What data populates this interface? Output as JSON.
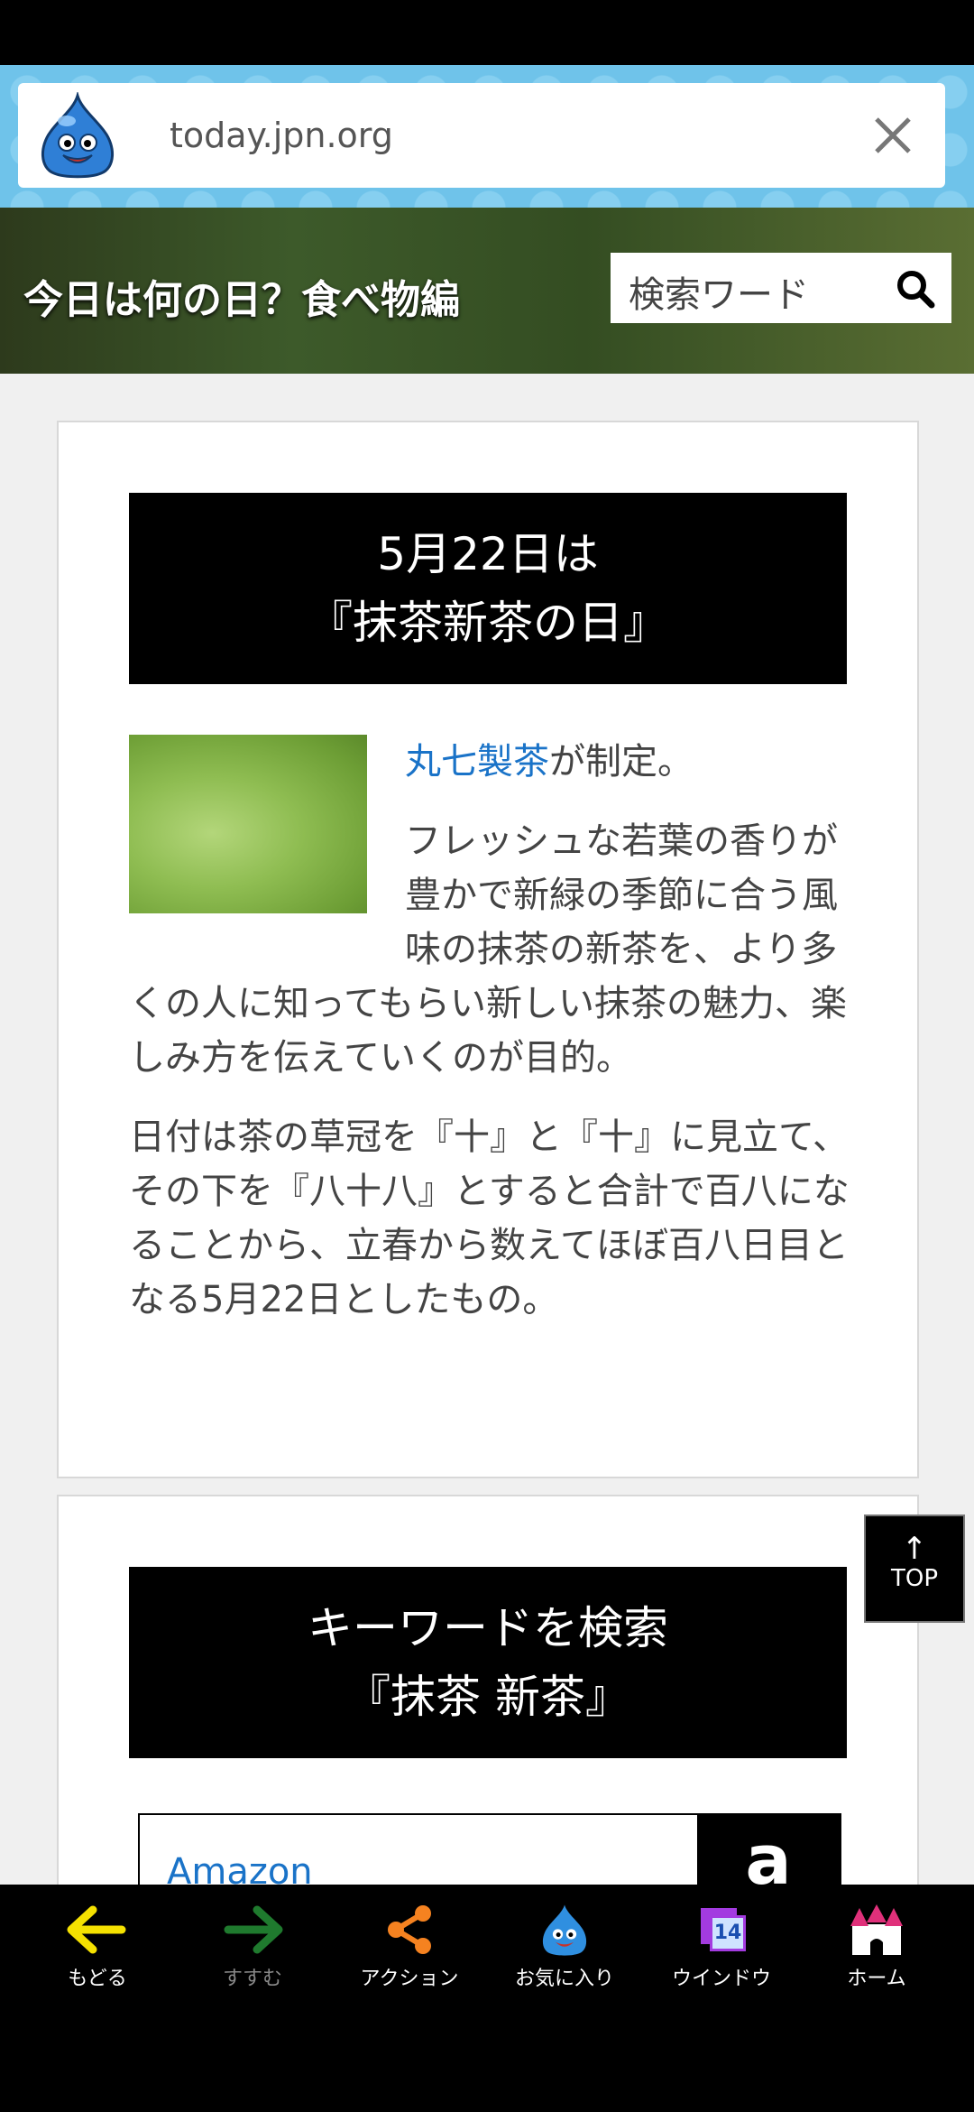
{
  "browser": {
    "url": "today.jpn.org"
  },
  "header": {
    "site_title": "今日は何の日？食べ物編",
    "search_placeholder": "検索ワード"
  },
  "article": {
    "title_line1": "5月22日は",
    "title_line2": "『抹茶新茶の日』",
    "maker_link": "丸七製茶",
    "maker_suffix": "が制定。",
    "paragraph1": "フレッシュな若葉の香りが豊かで新緑の季節に合う風味の抹茶の新茶を、より多くの人に知ってもらい新しい抹茶の魅力、楽しみ方を伝えていくのが目的。",
    "paragraph2": "日付は茶の草冠を『十』と『十』に見立て、その下を『八十八』とすると合計で百八になることから、立春から数えてほぼ百八日目となる5月22日としたもの。"
  },
  "keyword": {
    "title_line1": "キーワードを検索",
    "title_line2": "『抹茶 新茶』",
    "amazon_label": "Amazon",
    "amazon_logo": "a"
  },
  "top_button": {
    "arrow": "↑",
    "label": "TOP"
  },
  "nav": {
    "back": "もどる",
    "forward": "すすむ",
    "action": "アクション",
    "favorites": "お気に入り",
    "window": "ウインドウ",
    "window_count": "14",
    "home": "ホーム"
  }
}
